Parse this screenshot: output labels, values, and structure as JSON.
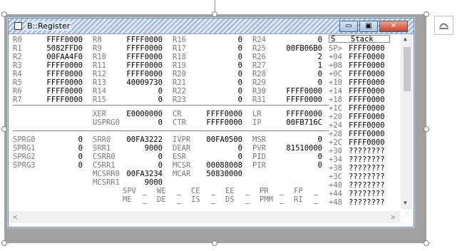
{
  "window": {
    "title": "B::Register"
  },
  "title_buttons": {
    "minimize": "▭",
    "maximize": "▣",
    "close": "✕"
  },
  "gpr": [
    [
      "R0",
      "FFFF0000",
      "R8",
      "FFFF0000",
      "R16",
      "0",
      "R24",
      "0"
    ],
    [
      "R1",
      "5082FFD0",
      "R9",
      "FFFF0000",
      "R17",
      "0",
      "R25",
      "00FB06B0"
    ],
    [
      "R2",
      "00FAA4F0",
      "R10",
      "FFFF0000",
      "R18",
      "0",
      "R26",
      "2"
    ],
    [
      "R3",
      "FFFF0000",
      "R11",
      "FFFF0000",
      "R19",
      "0",
      "R27",
      "1"
    ],
    [
      "R4",
      "FFFF0000",
      "R12",
      "FFFF0000",
      "R20",
      "0",
      "R28",
      "0"
    ],
    [
      "R5",
      "FFFF0000",
      "R13",
      "40009730",
      "R21",
      "0",
      "R29",
      "0"
    ],
    [
      "R6",
      "FFFF0000",
      "R14",
      "0",
      "R22",
      "0",
      "R30",
      "FFFF0000"
    ],
    [
      "R7",
      "FFFF0000",
      "R15",
      "0",
      "R23",
      "0",
      "R31",
      "FFFF0000"
    ]
  ],
  "spr1": [
    [
      "XER",
      "E0000000",
      "CR",
      "FFFF0000",
      "LR",
      "FFFF0000"
    ],
    [
      "USPRG0",
      "0",
      "CTR",
      "FFFF0000",
      "IP",
      "00FB716C"
    ]
  ],
  "spr2": [
    [
      "SPRG0",
      "0",
      "SRR0",
      "00FA3222",
      "IVPR",
      "00FA0500",
      "MSR",
      "0"
    ],
    [
      "SPRG1",
      "0",
      "SRR1",
      "9000",
      "DEAR",
      "0",
      "PVR",
      "81510000"
    ],
    [
      "SPRG2",
      "0",
      "CSRR0",
      "0",
      "ESR",
      "0",
      "PID",
      "0"
    ],
    [
      "SPRG3",
      "0",
      "CSRR1",
      "0",
      "MCSR",
      "00088008",
      "PIR",
      "0"
    ]
  ],
  "spr3": [
    [
      "MCSRR0",
      "00FA3234",
      "MCAR",
      "50830000"
    ],
    [
      "MCSRR1",
      "9000",
      "",
      ""
    ]
  ],
  "flags": [
    [
      "SPV",
      "_",
      "WE",
      "_",
      "CE",
      "_",
      "EE",
      "_",
      "PR",
      "_",
      "FP",
      "_"
    ],
    [
      "ME",
      "_",
      "DE",
      "_",
      "IS",
      "_",
      "DS",
      "_",
      "PMM",
      "_",
      "RI",
      "_"
    ]
  ],
  "stack": {
    "header_s": "S",
    "header_label": "Stack",
    "offsets": [
      "SP>",
      "+04",
      "+08",
      "+0C",
      "+10",
      "+14",
      "+18",
      "+1C",
      "+20",
      "+24",
      "+28",
      "+2C",
      "+30",
      "+34",
      "+38",
      "+3C",
      "+40",
      "+44",
      "+48"
    ],
    "values": [
      "FFFF0000",
      "FFFF0000",
      "FFFF0000",
      "FFFF0000",
      "FFFF0000",
      "FFFF0000",
      "FFFF0000",
      "FFFF0000",
      "FFFF0000",
      "FFFF0000",
      "FFFF0000",
      "FFFF0000",
      "????????",
      "????????",
      "????????",
      "????????",
      "????????",
      "????????",
      "????????"
    ]
  },
  "scroll": {
    "up": "▲",
    "down": "▼",
    "left": "<",
    "right": ">",
    "grip": "⋰"
  },
  "colors": {
    "label": "#7a7a7a",
    "value": "#000000",
    "title_blue": "#9cb4d2",
    "close_red": "#c8412a"
  }
}
